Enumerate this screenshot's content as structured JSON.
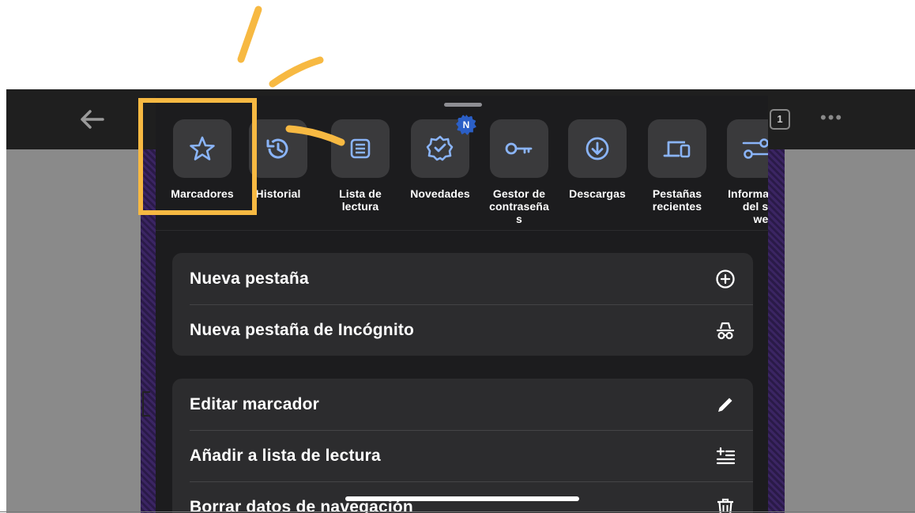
{
  "accent_color": "#f7b942",
  "browser": {
    "tab_count": "1",
    "back_icon": "arrow-left-icon",
    "more_icon": "more-dots-icon"
  },
  "shortcuts": [
    {
      "label": "Marcadores",
      "icon": "star-icon"
    },
    {
      "label": "Historial",
      "icon": "history-icon"
    },
    {
      "label": "Lista de\nlectura",
      "icon": "reading-list-icon"
    },
    {
      "label": "Novedades",
      "icon": "whats-new-icon",
      "badge": "N"
    },
    {
      "label": "Gestor de\ncontraseña\ns",
      "icon": "key-icon"
    },
    {
      "label": "Descargas",
      "icon": "download-icon"
    },
    {
      "label": "Pestañas\nrecientes",
      "icon": "devices-icon"
    },
    {
      "label": "Informac\ndel sit\nweb",
      "icon": "site-settings-icon"
    }
  ],
  "menu_group_1": [
    {
      "label": "Nueva pestaña",
      "icon": "plus-circle-icon"
    },
    {
      "label": "Nueva pestaña de Incógnito",
      "icon": "incognito-icon"
    }
  ],
  "menu_group_2": [
    {
      "label": "Editar marcador",
      "icon": "pencil-icon"
    },
    {
      "label": "Añadir a lista de lectura",
      "icon": "add-reading-list-icon"
    },
    {
      "label": "Borrar datos de navegación",
      "icon": "trash-icon"
    }
  ]
}
